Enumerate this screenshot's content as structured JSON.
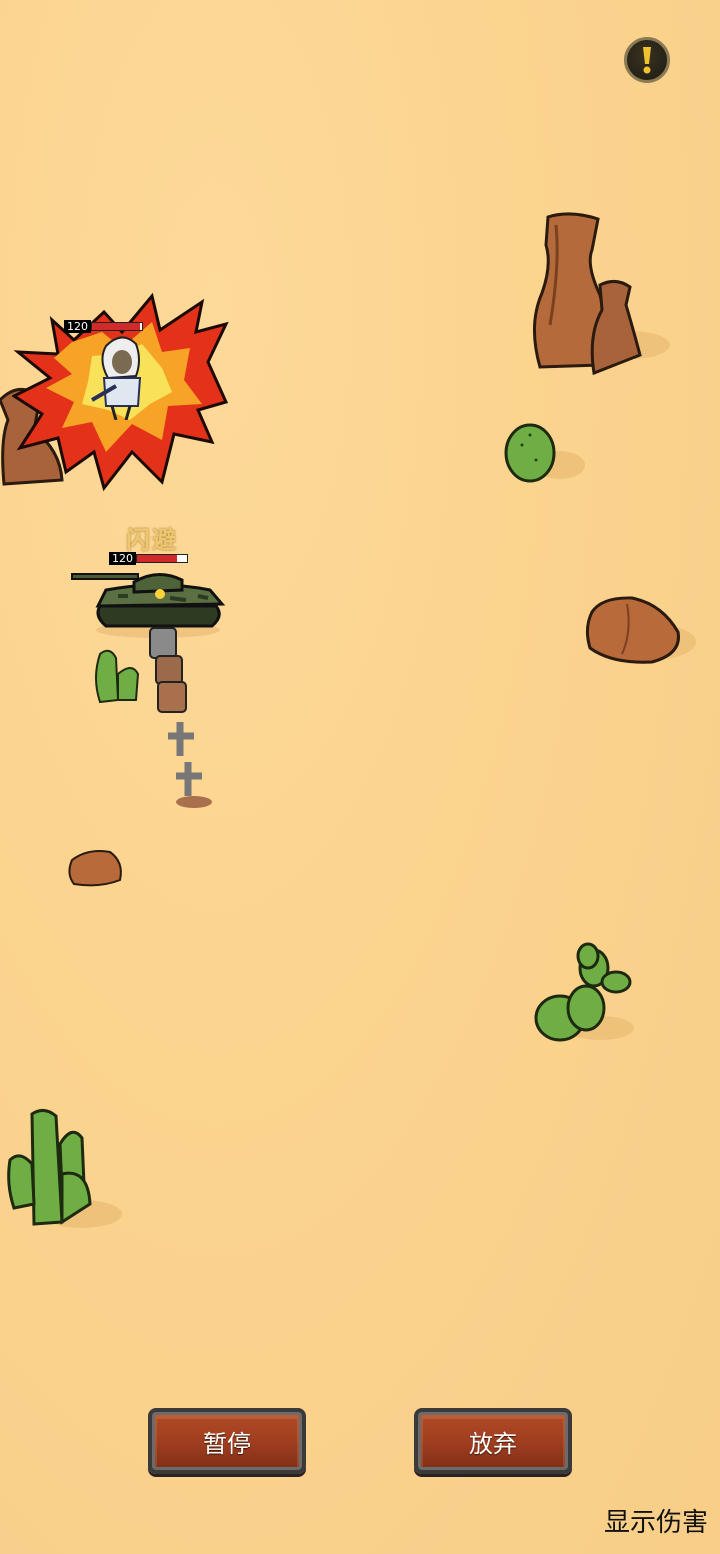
{
  "hud": {
    "info_icon": "exclamation-icon",
    "enemy_hp": 120,
    "enemy_hp_fraction": 0.95,
    "player_hp": 120,
    "player_hp_fraction": 0.8,
    "dodge_text": "闪避"
  },
  "controls": {
    "pause_label": "暂停",
    "abandon_label": "放弃",
    "show_damage_label": "显示伤害"
  },
  "colors": {
    "sand": "#fbd48f",
    "button": "#9e3d1f",
    "hp_fill": "#d02a2a"
  }
}
